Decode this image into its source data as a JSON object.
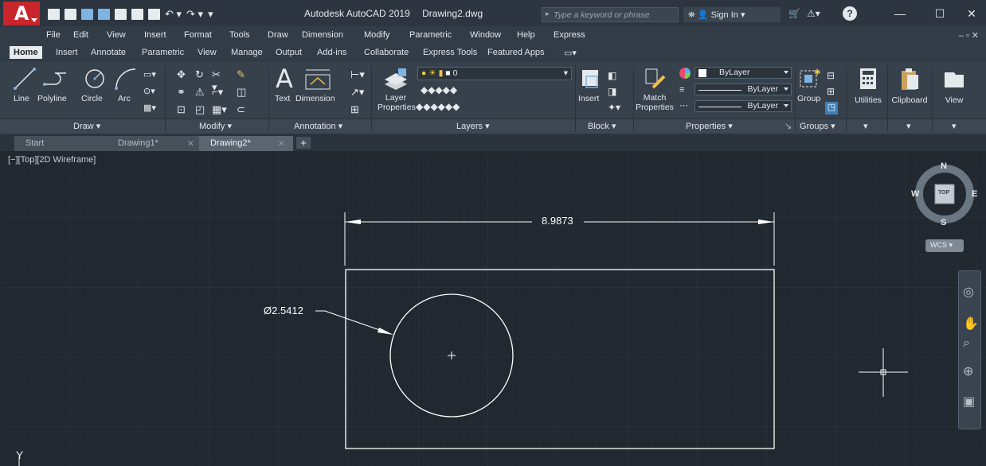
{
  "title": {
    "app": "Autodesk AutoCAD 2019",
    "file": "Drawing2.dwg",
    "search_placeholder": "Type a keyword or phrase",
    "sign_in": "Sign In"
  },
  "menu": [
    "File",
    "Edit",
    "View",
    "Insert",
    "Format",
    "Tools",
    "Draw",
    "Dimension",
    "Modify",
    "Parametric",
    "Window",
    "Help",
    "Express"
  ],
  "ribbon_tabs": [
    "Home",
    "Insert",
    "Annotate",
    "Parametric",
    "View",
    "Manage",
    "Output",
    "Add-ins",
    "Collaborate",
    "Express Tools",
    "Featured Apps"
  ],
  "draw_tools": {
    "line": "Line",
    "polyline": "Polyline",
    "circle": "Circle",
    "arc": "Arc"
  },
  "annotation_tools": {
    "text": "Text",
    "dimension": "Dimension"
  },
  "layers": {
    "properties_line1": "Layer",
    "properties_line2": "Properties",
    "current_layer": "0"
  },
  "block": {
    "insert": "Insert"
  },
  "properties": {
    "match_line1": "Match",
    "match_line2": "Properties",
    "color": "ByLayer",
    "linetype": "ByLayer",
    "lineweight": "ByLayer"
  },
  "groups": {
    "group": "Group"
  },
  "big_buttons": {
    "utilities": "Utilities",
    "clipboard": "Clipboard",
    "view": "View"
  },
  "panel_titles": {
    "draw": "Draw ▾",
    "modify": "Modify ▾",
    "annotation": "Annotation ▾",
    "layers": "Layers ▾",
    "block": "Block ▾",
    "properties": "Properties ▾",
    "groups": "Groups ▾"
  },
  "file_tabs": [
    "Start",
    "Drawing1*",
    "Drawing2*"
  ],
  "viewport_label": "[−][Top][2D Wireframe]",
  "viewcube": {
    "n": "N",
    "s": "S",
    "e": "E",
    "w": "W",
    "top": "TOP",
    "wcs": "WCS"
  },
  "drawing": {
    "dimension_value": "8.9873",
    "diameter_value": "Ø2.5412"
  },
  "ucs_label": "Y",
  "colors": {
    "canvas": "#212830",
    "line": "#ffffff",
    "accent_red": "#c8252d"
  }
}
